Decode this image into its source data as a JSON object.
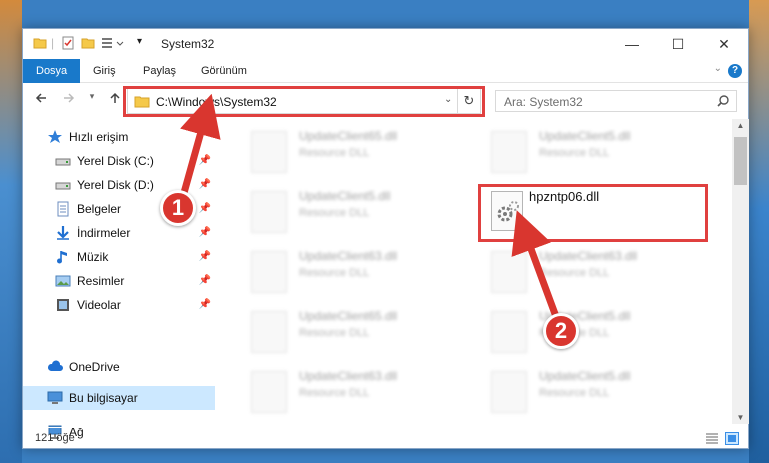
{
  "window": {
    "title": "System32",
    "minimize": "—",
    "maximize": "☐",
    "close": "✕"
  },
  "ribbon": {
    "tabs": [
      "Dosya",
      "Giriş",
      "Paylaş",
      "Görünüm"
    ],
    "help": "?"
  },
  "navbar": {
    "address": "C:\\Windows\\System32",
    "search_placeholder": "Ara: System32"
  },
  "sidebar": {
    "items": [
      {
        "label": "Hızlı erişim",
        "icon": "star-icon",
        "pinned": false
      },
      {
        "label": "Yerel Disk (C:)",
        "icon": "drive-icon",
        "pinned": true
      },
      {
        "label": "Yerel Disk (D:)",
        "icon": "drive-icon",
        "pinned": true
      },
      {
        "label": "Belgeler",
        "icon": "document-icon",
        "pinned": true
      },
      {
        "label": "İndirmeler",
        "icon": "download-icon",
        "pinned": true
      },
      {
        "label": "Müzik",
        "icon": "music-icon",
        "pinned": true
      },
      {
        "label": "Resimler",
        "icon": "pictures-icon",
        "pinned": true
      },
      {
        "label": "Videolar",
        "icon": "video-icon",
        "pinned": true
      },
      {
        "label": "OneDrive",
        "icon": "cloud-icon",
        "pinned": false
      },
      {
        "label": "Bu bilgisayar",
        "icon": "computer-icon",
        "pinned": false
      },
      {
        "label": "Ağ",
        "icon": "network-icon",
        "pinned": false
      }
    ]
  },
  "files": {
    "left": [
      {
        "name": "UpdateClient65.dll",
        "desc": "Resource DLL"
      },
      {
        "name": "UpdateClient5.dll",
        "desc": "Resource DLL"
      },
      {
        "name": "UpdateClient63.dll",
        "desc": "Resource DLL"
      },
      {
        "name": "UpdateClient65.dll",
        "desc": "Resource DLL"
      },
      {
        "name": "UpdateClient63.dll",
        "desc": "Resource DLL"
      }
    ],
    "right": [
      {
        "name": "UpdateClient5.dll",
        "desc": "Resource DLL"
      },
      {
        "name": "hpzntp06.dll",
        "desc": ""
      },
      {
        "name": "UpdateClient63.dll",
        "desc": "Resource DLL"
      },
      {
        "name": "UpdateClient5.dll",
        "desc": "Resource DLL"
      },
      {
        "name": "UpdateClient5.dll",
        "desc": "Resource DLL"
      }
    ]
  },
  "status": {
    "count": "121 öğe"
  },
  "annotations": {
    "badge1": "1",
    "badge2": "2",
    "color": "#d9362f"
  }
}
